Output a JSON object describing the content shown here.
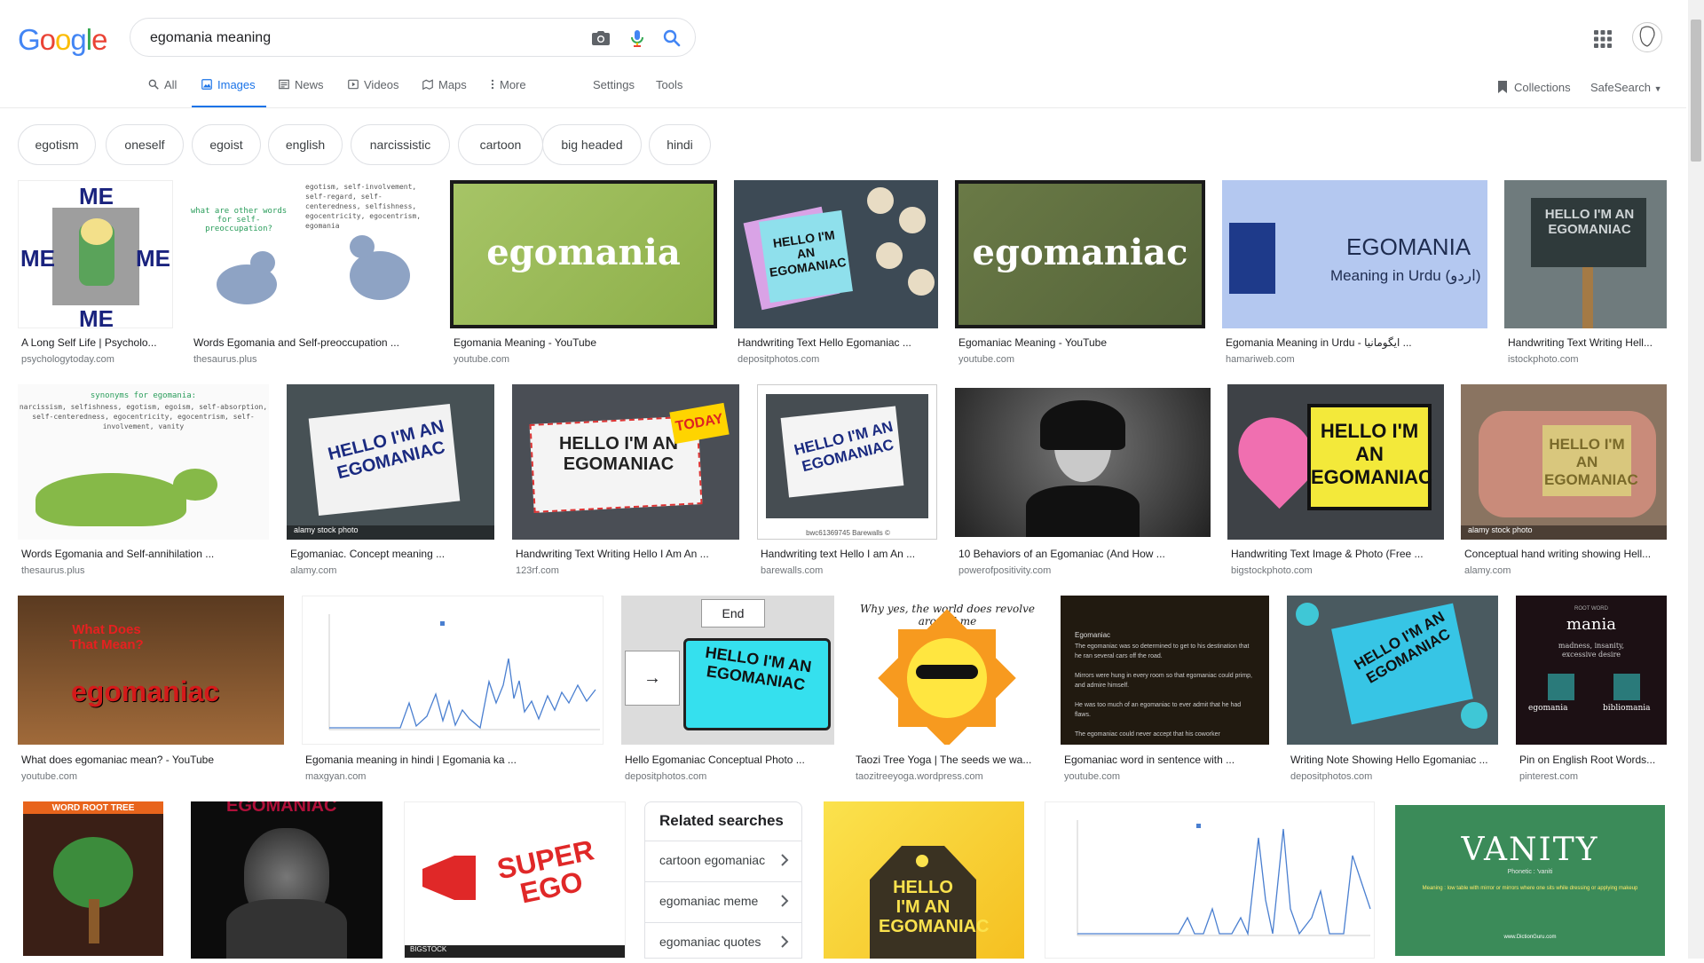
{
  "logo": {
    "text": "Google"
  },
  "search": {
    "query": "egomania meaning"
  },
  "tabs": [
    {
      "label": "All",
      "icon": "search-icon"
    },
    {
      "label": "Images",
      "icon": "image-icon",
      "active": true
    },
    {
      "label": "News",
      "icon": "news-icon"
    },
    {
      "label": "Videos",
      "icon": "video-icon"
    },
    {
      "label": "Maps",
      "icon": "map-icon"
    },
    {
      "label": "More",
      "icon": "more-vert-icon"
    }
  ],
  "settings_label": "Settings",
  "tools_label": "Tools",
  "collections_label": "Collections",
  "safesearch_label": "SafeSearch",
  "chips": [
    "egotism",
    "oneself",
    "egoist",
    "english",
    "narcissistic",
    "cartoon",
    "big headed",
    "hindi"
  ],
  "results": [
    {
      "title": "A Long Self Life | Psycholo...",
      "source": "psychologytoday.com",
      "thumb_text": "ME ME ME ME"
    },
    {
      "title": "Words Egomania and Self-preoccupation ...",
      "source": "thesaurus.plus",
      "thumb_text": "what are other words for self-preoccupation?"
    },
    {
      "title": "Egomania Meaning - YouTube",
      "source": "youtube.com",
      "thumb_text": "egomania"
    },
    {
      "title": "Handwriting Text Hello Egomaniac ...",
      "source": "depositphotos.com",
      "thumb_text": "HELLO I'M AN EGOMANIAC"
    },
    {
      "title": "Egomaniac Meaning - YouTube",
      "source": "youtube.com",
      "thumb_text": "egomaniac"
    },
    {
      "title": "Egomania Meaning in Urdu - ایگومانیا ...",
      "source": "hamariweb.com",
      "thumb_text": "EGOMANIA",
      "thumb_sub": "Meaning in Urdu (اردو)"
    },
    {
      "title": "Handwriting Text Writing Hell...",
      "source": "istockphoto.com",
      "thumb_text": "HELLO I'M AN EGOMANIAC"
    },
    {
      "title": "Words Egomania and Self-annihilation ...",
      "source": "thesaurus.plus",
      "thumb_text": "synonyms for egomania:"
    },
    {
      "title": "Egomaniac. Concept meaning ...",
      "source": "alamy.com",
      "thumb_text": "HELLO I'M AN EGOMANIAC"
    },
    {
      "title": "Handwriting Text Writing Hello I Am An ...",
      "source": "123rf.com",
      "thumb_text": "HELLO I'M AN EGOMANIAC"
    },
    {
      "title": "Handwriting text Hello I am An ...",
      "source": "barewalls.com",
      "thumb_text": "HELLO I'M AN EGOMANIAC"
    },
    {
      "title": "10 Behaviors of an Egomaniac (And How ...",
      "source": "powerofpositivity.com",
      "thumb_text": ""
    },
    {
      "title": "Handwriting Text Image & Photo (Free ...",
      "source": "bigstockphoto.com",
      "thumb_text": "HELLO I'M AN EGOMANIAC"
    },
    {
      "title": "Conceptual hand writing showing Hell...",
      "source": "alamy.com",
      "thumb_text": "HELLO I'M AN EGOMANIAC"
    },
    {
      "title": "What does egomaniac mean? - YouTube",
      "source": "youtube.com",
      "thumb_text": "egomaniac",
      "thumb_sub": "What Does That Mean?"
    },
    {
      "title": "Egomania meaning in hindi | Egomania ka ...",
      "source": "maxgyan.com",
      "thumb_text": ""
    },
    {
      "title": "Hello Egomaniac Conceptual Photo ...",
      "source": "depositphotos.com",
      "thumb_text": "HELLO I'M AN EGOMANIAC"
    },
    {
      "title": "Taozi Tree Yoga | The seeds we wa...",
      "source": "taozitreeyoga.wordpress.com",
      "thumb_text": "Why yes, the world does revolve around me"
    },
    {
      "title": "Egomaniac word in sentence with ...",
      "source": "youtube.com",
      "thumb_text": "Egomaniac"
    },
    {
      "title": "Writing Note Showing Hello Egomaniac ...",
      "source": "depositphotos.com",
      "thumb_text": "HELLO I'M AN EGOMANIAC"
    },
    {
      "title": "Pin on English Root Words...",
      "source": "pinterest.com",
      "thumb_text": "mania"
    },
    {
      "title": "",
      "source": "",
      "thumb_text": "WORD ROOT TREE"
    },
    {
      "title": "",
      "source": "",
      "thumb_text": "EGOMANIAC"
    },
    {
      "title": "",
      "source": "",
      "thumb_text": "SUPER EGO"
    },
    {
      "title": "",
      "source": "",
      "thumb_text": "HELLO I'M AN EGOMANIAC"
    },
    {
      "title": "",
      "source": "",
      "thumb_text": ""
    },
    {
      "title": "",
      "source": "",
      "thumb_text": "VANITY"
    }
  ],
  "related": {
    "title": "Related searches",
    "items": [
      "cartoon egomaniac",
      "egomaniac meme",
      "egomaniac quotes"
    ]
  }
}
